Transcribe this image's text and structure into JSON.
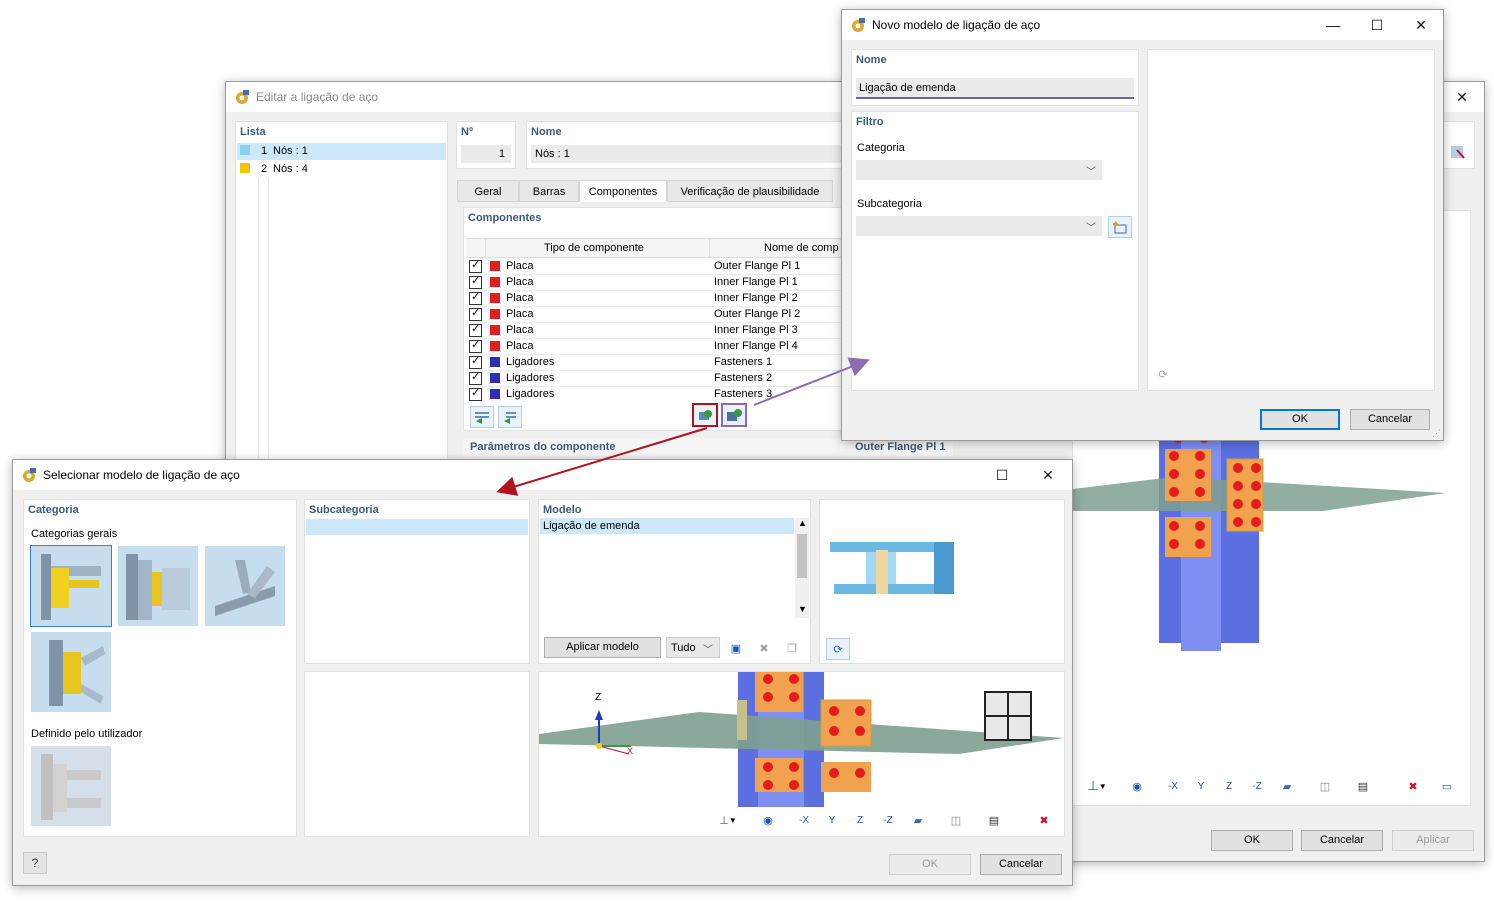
{
  "edit_dialog": {
    "title": "Editar a ligação de aço",
    "list": {
      "title": "Lista",
      "items": [
        {
          "num": "1",
          "label": "Nós : 1",
          "color": "#8ad2f4"
        },
        {
          "num": "2",
          "label": "Nós : 4",
          "color": "#f1c400"
        }
      ]
    },
    "no_label": "Nº",
    "no_value": "1",
    "name_label": "Nome",
    "name_value": "Nós : 1",
    "tabs": [
      "Geral",
      "Barras",
      "Componentes",
      "Verificação de plausibilidade"
    ],
    "components_title": "Componentes",
    "columns": [
      "Tipo de componente",
      "Nome de comp"
    ],
    "components": [
      {
        "type": "Placa",
        "name": "Outer Flange Pl 1",
        "color": "#e51c1c"
      },
      {
        "type": "Placa",
        "name": "Inner Flange Pl 1",
        "color": "#e51c1c"
      },
      {
        "type": "Placa",
        "name": "Inner Flange Pl 2",
        "color": "#e51c1c"
      },
      {
        "type": "Placa",
        "name": "Outer Flange Pl 2",
        "color": "#e51c1c"
      },
      {
        "type": "Placa",
        "name": "Inner Flange Pl 3",
        "color": "#e51c1c"
      },
      {
        "type": "Placa",
        "name": "Inner Flange Pl 4",
        "color": "#e51c1c"
      },
      {
        "type": "Ligadores",
        "name": "Fasteners 1",
        "color": "#2d2db8"
      },
      {
        "type": "Ligadores",
        "name": "Fasteners 2",
        "color": "#2d2db8"
      },
      {
        "type": "Ligadores",
        "name": "Fasteners 3",
        "color": "#2d2db8"
      }
    ],
    "params_title": "Parâmetros do componente",
    "params_value": "Outer Flange Pl 1",
    "ok": "OK",
    "cancel": "Cancelar",
    "apply": "Aplicar"
  },
  "new_dialog": {
    "title": "Novo modelo de ligação de aço",
    "name_title": "Nome",
    "name_value": "Ligação de emenda",
    "filter_title": "Filtro",
    "category_label": "Categoria",
    "subcategory_label": "Subcategoria",
    "ok": "OK",
    "cancel": "Cancelar"
  },
  "select_dialog": {
    "title": "Selecionar modelo de ligação de aço",
    "category_title": "Categoria",
    "general_label": "Categorias gerais",
    "user_label": "Definido pelo utilizador",
    "subcategory_title": "Subcategoria",
    "model_title": "Modelo",
    "model_items": [
      "Ligação de emenda"
    ],
    "apply_model": "Aplicar modelo",
    "filter_all": "Tudo",
    "axis_z": "Z",
    "axis_x": "X",
    "ok": "OK",
    "cancel": "Cancelar"
  },
  "colors": {
    "accent": "#0078d7",
    "highlight_red": "#b4111b",
    "highlight_purple": "#8c6bb1",
    "column_blue": "#5b6fe0",
    "plate_orange": "#f0a24e",
    "bolt_red": "#e51c1c"
  }
}
